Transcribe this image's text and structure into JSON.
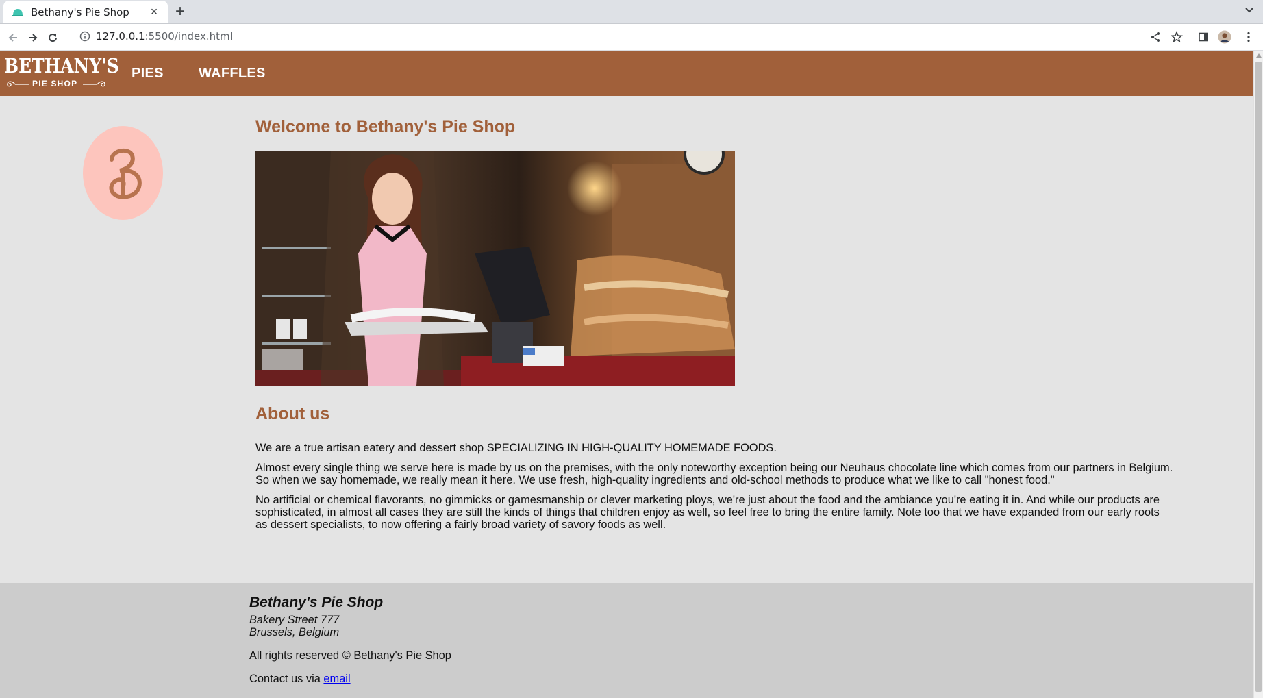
{
  "browser": {
    "tab_title": "Bethany's Pie Shop",
    "tab_close": "×",
    "new_tab": "+",
    "url_host": "127.0.0.1",
    "url_rest": ":5500/index.html"
  },
  "site": {
    "brand_main": "BETHANY'S",
    "brand_sub": "PIE SHOP",
    "nav": [
      "PIES",
      "WAFFLES"
    ],
    "logo_letter": "B",
    "brand_color": "#a1603a",
    "badge_color": "#fdc5bd"
  },
  "main": {
    "welcome_heading": "Welcome to Bethany's Pie Shop",
    "about_heading": "About us",
    "paragraphs": [
      "We are a true artisan eatery and dessert shop SPECIALIZING IN HIGH-QUALITY HOMEMADE FOODS.",
      "Almost every single thing we serve here is made by us on the premises, with the only noteworthy exception being our Neuhaus chocolate line which comes from our partners in Belgium. So when we say homemade, we really mean it here. We use fresh, high-quality ingredients and old-school methods to produce what we like to call \"honest food.\"",
      "No artificial or chemical flavorants, no gimmicks or gamesmanship or clever marketing ploys, we're just about the food and the ambiance you're eating it in. And while our products are sophisticated, in almost all cases they are still the kinds of things that children enjoy as well, so feel free to bring the entire family. Note too that we have expanded from our early roots as dessert specialists, to now offering a fairly broad variety of savory foods as well."
    ]
  },
  "footer": {
    "name": "Bethany's Pie Shop",
    "street": "Bakery Street 777",
    "city": "Brussels, Belgium",
    "rights": "All rights reserved © Bethany's Pie Shop",
    "contact_prefix": "Contact us via ",
    "contact_link": "email"
  }
}
